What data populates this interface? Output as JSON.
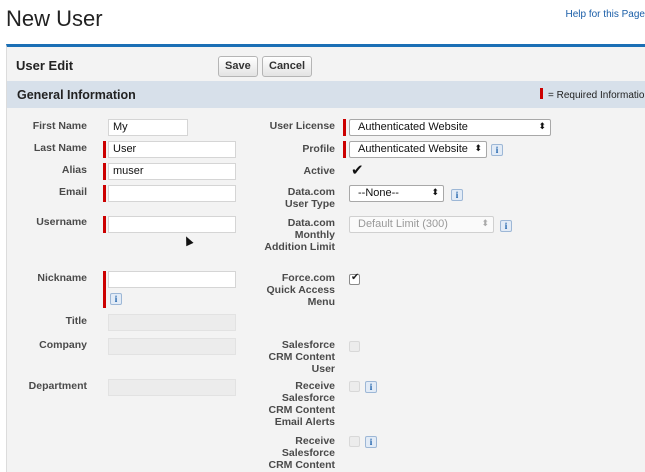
{
  "page": {
    "title": "New User",
    "help_link": "Help for this Page"
  },
  "panel": {
    "title": "User Edit",
    "save_label": "Save",
    "cancel_label": "Cancel"
  },
  "section": {
    "title": "General Information",
    "required_legend": "= Required Information"
  },
  "left_fields": {
    "first_name": {
      "label": "First Name",
      "value": "My"
    },
    "last_name": {
      "label": "Last Name",
      "value": "User"
    },
    "alias": {
      "label": "Alias",
      "value": "muser"
    },
    "email": {
      "label": "Email",
      "value": ""
    },
    "username": {
      "label": "Username",
      "value": ""
    },
    "nickname": {
      "label": "Nickname",
      "value": ""
    },
    "title": {
      "label": "Title",
      "value": ""
    },
    "company": {
      "label": "Company",
      "value": ""
    },
    "department": {
      "label": "Department",
      "value": ""
    }
  },
  "right_fields": {
    "user_license": {
      "label": "User License",
      "value": "Authenticated Website"
    },
    "profile": {
      "label": "Profile",
      "value": "Authenticated Website"
    },
    "active": {
      "label": "Active",
      "checked": true
    },
    "datacom_user_type": {
      "label": "Data.com User Type",
      "value": "--None--"
    },
    "datacom_monthly_limit": {
      "label": "Data.com Monthly Addition Limit",
      "value": "Default Limit (300)"
    },
    "force_quick_access": {
      "label": "Force.com Quick Access Menu",
      "checked": true
    },
    "crm_content_user": {
      "label": "Salesforce CRM Content User",
      "checked": false
    },
    "crm_content_email_alerts": {
      "label": "Receive Salesforce CRM Content Email Alerts",
      "checked": false
    },
    "crm_content_alerts_digest": {
      "label": "Receive Salesforce CRM Content",
      "checked": false
    }
  },
  "colors": {
    "accent": "#1b6fb5",
    "required": "#cc0000",
    "section_bg": "#d7e0ea",
    "panel_bg": "#f3f3f3"
  }
}
